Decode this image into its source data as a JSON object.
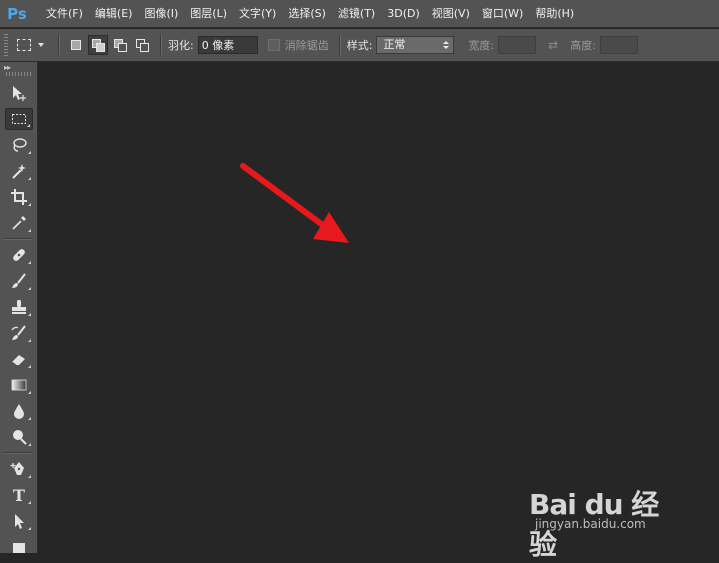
{
  "app": {
    "logo": "Ps",
    "colors": {
      "accent": "#4ea6ea",
      "annotation_arrow": "#e8191d"
    }
  },
  "menu": {
    "items": [
      "文件(F)",
      "编辑(E)",
      "图像(I)",
      "图层(L)",
      "文字(Y)",
      "选择(S)",
      "滤镜(T)",
      "3D(D)",
      "视图(V)",
      "窗口(W)",
      "帮助(H)"
    ]
  },
  "options": {
    "tool_preset_icon": "rect-marquee-icon",
    "selection_modes": [
      "new-selection-icon",
      "add-to-selection-icon",
      "subtract-from-selection-icon",
      "intersect-selection-icon"
    ],
    "feather_label": "羽化:",
    "feather_value": "0 像素",
    "antialias_label": "消除锯齿",
    "style_label": "样式:",
    "style_value": "正常",
    "width_label": "宽度:",
    "height_label": "高度:",
    "swap_icon": "swap-arrows-icon"
  },
  "toolbox": {
    "header": "▸▸",
    "tools": [
      "move-icon",
      "rect-marquee-icon",
      "lasso-icon",
      "magic-wand-icon",
      "crop-icon",
      "eyedropper-icon",
      "healing-brush-icon",
      "brush-icon",
      "clone-stamp-icon",
      "history-brush-icon",
      "eraser-icon",
      "gradient-icon",
      "blur-icon",
      "dodge-icon",
      "pen-icon",
      "type-icon",
      "path-selection-icon",
      "shape-icon"
    ],
    "type_glyph": "T"
  },
  "watermark": {
    "logo_text": "Bai du 经验",
    "url": "jingyan.baidu.com"
  }
}
